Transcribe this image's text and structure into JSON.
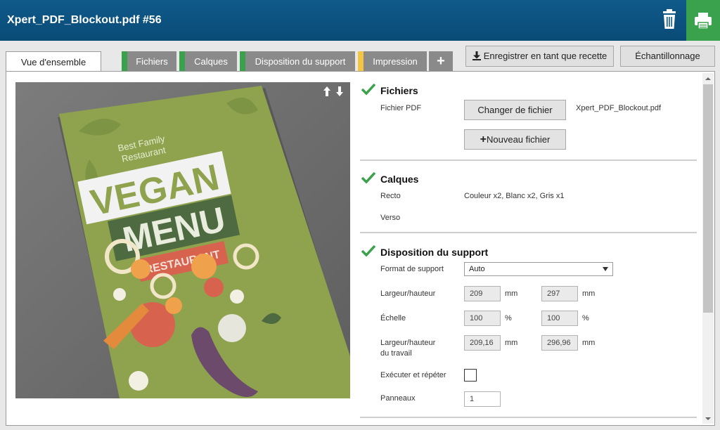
{
  "window": {
    "title": "Xpert_PDF_Blockout.pdf #56"
  },
  "toolbar": {
    "trash_icon": "trash-icon",
    "print_icon": "printer-icon"
  },
  "tabs": [
    {
      "label": "Vue d'ensemble",
      "active": true
    },
    {
      "label": "Fichiers",
      "status_color": "#3aa14c"
    },
    {
      "label": "Calques",
      "status_color": "#3aa14c"
    },
    {
      "label": "Disposition du support",
      "status_color": "#3aa14c"
    },
    {
      "label": "Impression",
      "status_color": "#f4c542"
    },
    {
      "label": "+",
      "icon": "plus-icon"
    }
  ],
  "actions": {
    "save_recipe_label": "Enregistrer en tant que recette",
    "sampling_label": "Échantillonnage"
  },
  "preview": {
    "menu_subtitle_line1": "Best Family",
    "menu_subtitle_line2": "Restaurant",
    "menu_title1": "VEGAN",
    "menu_title2": "MENU",
    "menu_ribbon": "RESTAURANT"
  },
  "files": {
    "title": "Fichiers",
    "pdf_label": "Fichier PDF",
    "change_button": "Changer de fichier",
    "file_name": "Xpert_PDF_Blockout.pdf",
    "new_button": "Nouveau fichier"
  },
  "layers": {
    "title": "Calques",
    "recto_label": "Recto",
    "recto_value": "Couleur x2, Blanc x2, Gris x1",
    "verso_label": "Verso"
  },
  "layout": {
    "title": "Disposition du support",
    "format_label": "Format de support",
    "format_value": "Auto",
    "size_label": "Largeur/hauteur",
    "width": "209",
    "height": "297",
    "unit_mm": "mm",
    "scale_label": "Échelle",
    "scale_x": "100",
    "scale_y": "100",
    "unit_pct": "%",
    "job_size_label1": "Largeur/hauteur",
    "job_size_label2": "du travail",
    "job_width": "209,16",
    "job_height": "296,96",
    "step_repeat_label": "Exécuter et répéter",
    "panels_label": "Panneaux",
    "panels_value": "1"
  },
  "colors": {
    "accent_green": "#3aa14c",
    "header_blue": "#0f5a8a",
    "warning_yellow": "#f4c542"
  }
}
